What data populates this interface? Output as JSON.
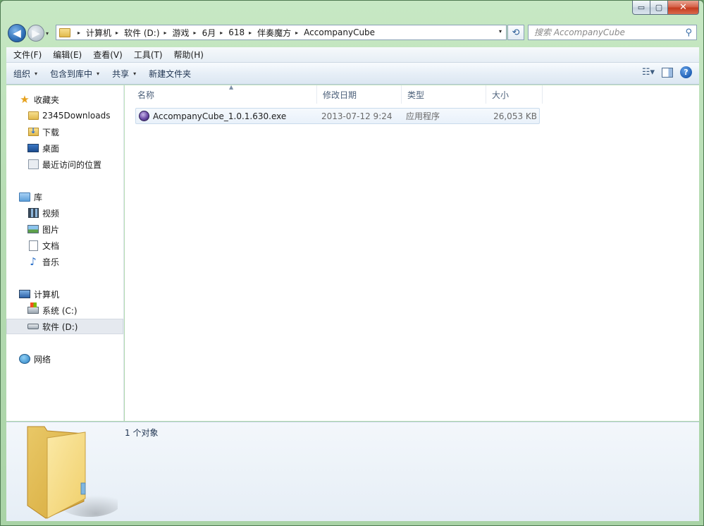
{
  "window": {
    "controls": {
      "minimize": "▭",
      "maximize": "▢",
      "close": "✕"
    }
  },
  "nav": {
    "back": "◀",
    "forward": "▶",
    "history_caret": "▾"
  },
  "address": {
    "crumbs": [
      "计算机",
      "软件 (D:)",
      "游戏",
      "6月",
      "618",
      "伴奏魔方",
      "AccompanyCube"
    ],
    "separator": "▸",
    "drop": "▾",
    "refresh": "⟲"
  },
  "search": {
    "placeholder": "搜索 AccompanyCube",
    "icon": "⚲"
  },
  "menu": [
    "文件(F)",
    "编辑(E)",
    "查看(V)",
    "工具(T)",
    "帮助(H)"
  ],
  "commands": {
    "organize": "组织",
    "include_in_library": "包含到库中",
    "share": "共享",
    "new_folder": "新建文件夹",
    "caret": "▾",
    "view": "☷▾",
    "help": "?"
  },
  "sidebar": {
    "favorites": {
      "label": "收藏夹",
      "items": [
        "2345Downloads",
        "下载",
        "桌面",
        "最近访问的位置"
      ]
    },
    "libraries": {
      "label": "库",
      "items": [
        "视频",
        "图片",
        "文档",
        "音乐"
      ]
    },
    "computer": {
      "label": "计算机",
      "items": [
        "系统 (C:)",
        "软件 (D:)"
      ]
    },
    "network": {
      "label": "网络"
    },
    "star": "★",
    "note": "♪"
  },
  "columns": {
    "name": "名称",
    "date": "修改日期",
    "type": "类型",
    "size": "大小",
    "sort": "▲"
  },
  "files": [
    {
      "name": "AccompanyCube_1.0.1.630.exe",
      "date": "2013-07-12 9:24",
      "type": "应用程序",
      "size": "26,053 KB"
    }
  ],
  "details": {
    "count": "1 个对象"
  }
}
